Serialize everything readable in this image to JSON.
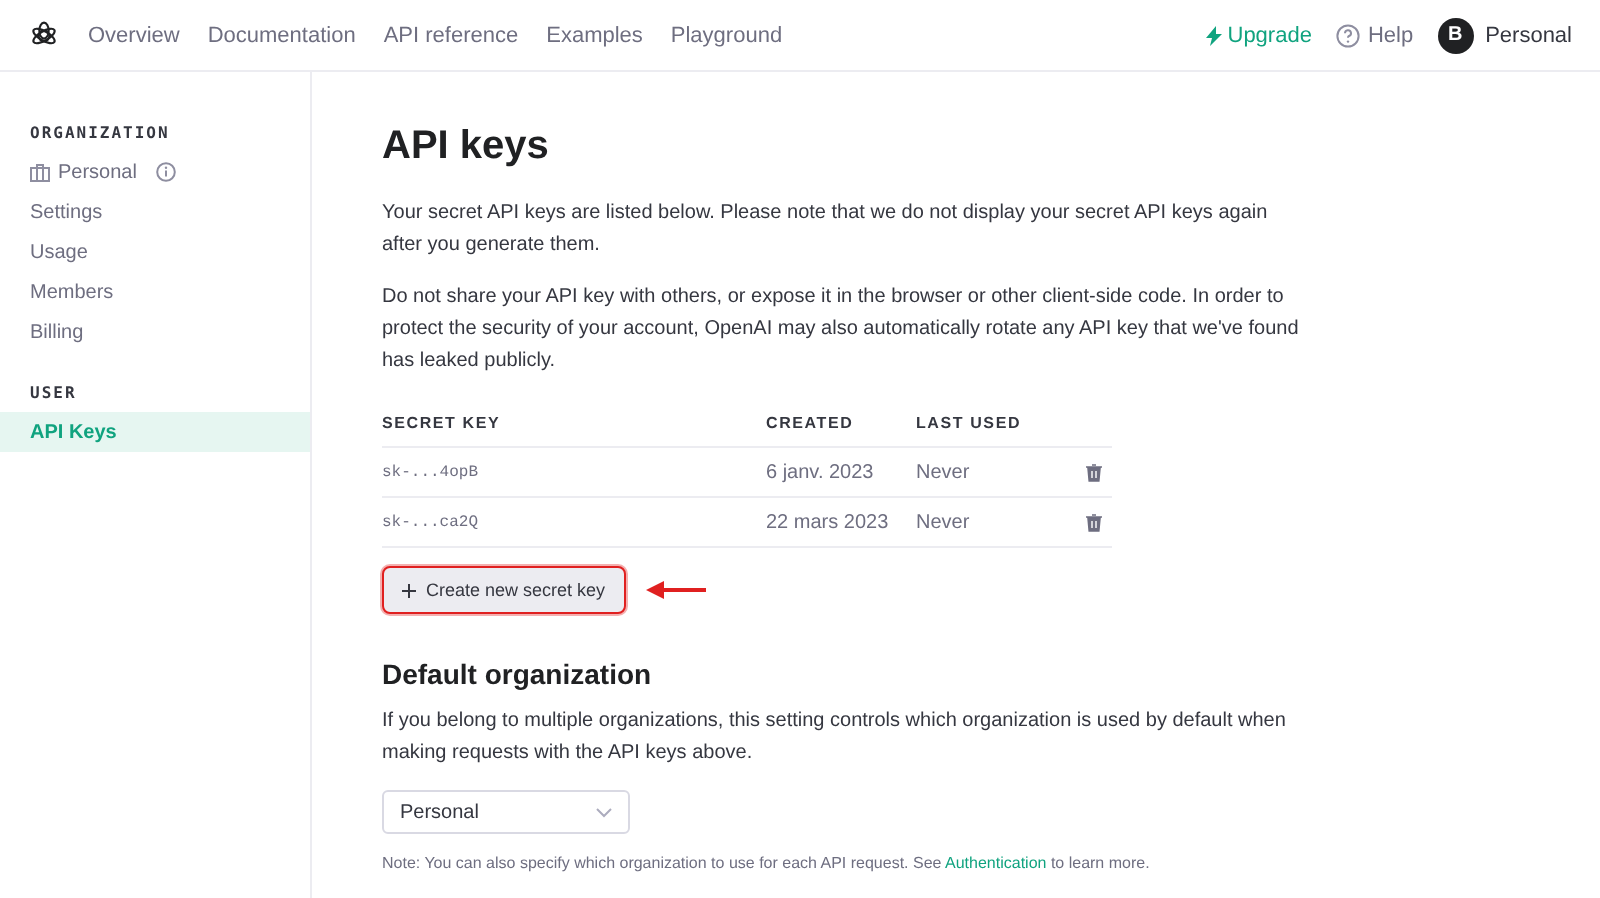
{
  "nav": {
    "links": [
      "Overview",
      "Documentation",
      "API reference",
      "Examples",
      "Playground"
    ],
    "upgrade": "Upgrade",
    "help": "Help",
    "avatar": "B",
    "account": "Personal"
  },
  "sidebar": {
    "sections": [
      {
        "heading": "ORGANIZATION",
        "items": [
          {
            "label": "Personal",
            "kind": "org",
            "selected": false
          },
          {
            "label": "Settings",
            "kind": "link",
            "selected": false
          },
          {
            "label": "Usage",
            "kind": "link",
            "selected": false
          },
          {
            "label": "Members",
            "kind": "link",
            "selected": false
          },
          {
            "label": "Billing",
            "kind": "link",
            "selected": false
          }
        ]
      },
      {
        "heading": "USER",
        "items": [
          {
            "label": "API Keys",
            "kind": "link",
            "selected": true
          }
        ]
      }
    ]
  },
  "title": "API keys",
  "paragraphs": [
    "Your secret API keys are listed below. Please note that we do not display your secret API keys again after you generate them.",
    "Do not share your API key with others, or expose it in the browser or other client-side code. In order to protect the security of your account, OpenAI may also automatically rotate any API key that we've found has leaked publicly."
  ],
  "table": {
    "columns": [
      "SECRET KEY",
      "CREATED",
      "LAST USED"
    ],
    "rows": [
      {
        "key": "sk-...4opB",
        "created": "6 janv. 2023",
        "last_used": "Never"
      },
      {
        "key": "sk-...ca2Q",
        "created": "22 mars 2023",
        "last_used": "Never"
      }
    ]
  },
  "create_button": "Create new secret key",
  "default_org": {
    "heading": "Default organization",
    "text": "If you belong to multiple organizations, this setting controls which organization is used by default when making requests with the API keys above.",
    "select_value": "Personal"
  },
  "note": {
    "before": "Note: You can also specify which organization to use for each API request. See ",
    "link": "Authentication",
    "after": " to learn more."
  }
}
